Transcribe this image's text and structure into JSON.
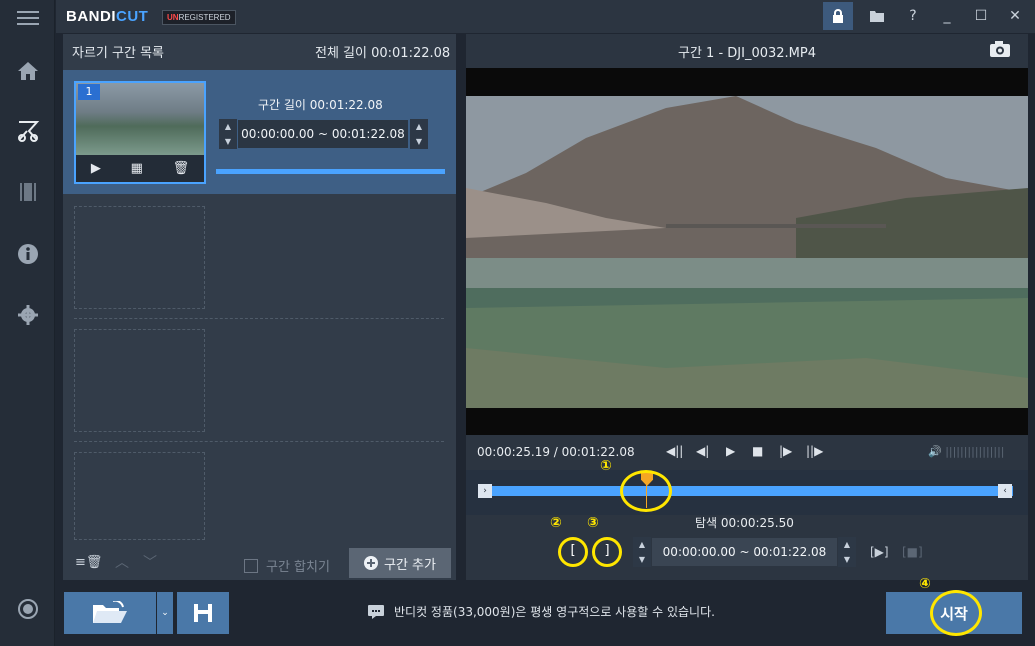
{
  "app": {
    "brand_bandi": "BANDI",
    "brand_cut": "CUT",
    "unreg_un": "UN",
    "unreg_rest": "REGISTERED"
  },
  "titlebar": {
    "help": "?",
    "minimize": "_",
    "maximize": "☐",
    "close": "✕"
  },
  "left_panel": {
    "title": "자르기 구간 목록",
    "total_label": "전체 길이 00:01:22.08",
    "segment": {
      "number": "1",
      "length_label": "구간 길이 00:01:22.08",
      "range": "00:00:00.00  ~  00:01:22.08",
      "progress": 1.0
    },
    "merge_label": "구간 합치기",
    "add_label": "구간 추가"
  },
  "right_panel": {
    "title": "구간 1 - DJI_0032.MP4",
    "current_time": "00:00:25.19 / 00:01:22.08",
    "seek_label": "탐색 00:00:25.50",
    "range": "00:00:00.00  ~  00:01:22.08",
    "playhead_fraction": 0.31,
    "annotations": [
      "①",
      "②",
      "③",
      "④"
    ]
  },
  "footer": {
    "promo": "반디컷 정품(33,000원)은 평생 영구적으로 사용할 수 있습니다.",
    "start_label": "시작"
  },
  "icons": {
    "menu": "hamburger-icon",
    "home": "home-icon",
    "cut": "scissors-icon",
    "film": "film-icon",
    "info": "info-icon",
    "settings": "gear-icon",
    "record": "record-icon"
  }
}
